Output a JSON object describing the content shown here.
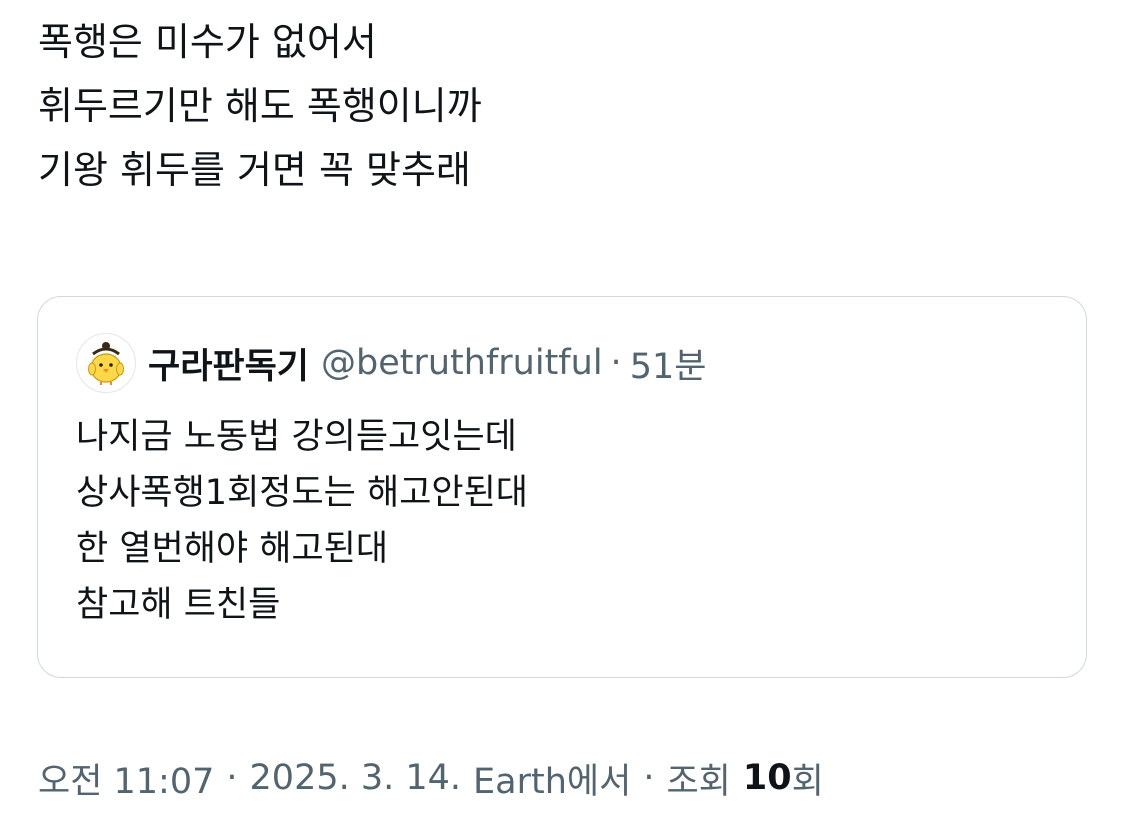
{
  "tweet": {
    "lines": [
      "폭행은 미수가 없어서",
      "휘두르기만 해도 폭행이니까",
      "기왕 휘두를 거면 꼭 맞추래"
    ]
  },
  "quote": {
    "avatar_icon": "yellow-chick-avatar-icon",
    "display_name": "구라판독기",
    "handle": "@betruthfruitful",
    "separator": "·",
    "time": "51분",
    "lines": [
      "나지금 노동법 강의듣고잇는데",
      "상사폭행1회정도는 해고안된대",
      "한 열번해야 해고된대",
      "참고해 트친들"
    ]
  },
  "meta": {
    "time": "오전 11:07",
    "date": "2025. 3. 14.",
    "source": "Earth에서",
    "views_label": "조회",
    "views_count": "10",
    "views_suffix": "회",
    "separator": "·"
  },
  "colors": {
    "text_primary": "#0f1419",
    "text_secondary": "#536471",
    "border": "#cfd9de",
    "chick_yellow": "#ffd84a"
  }
}
